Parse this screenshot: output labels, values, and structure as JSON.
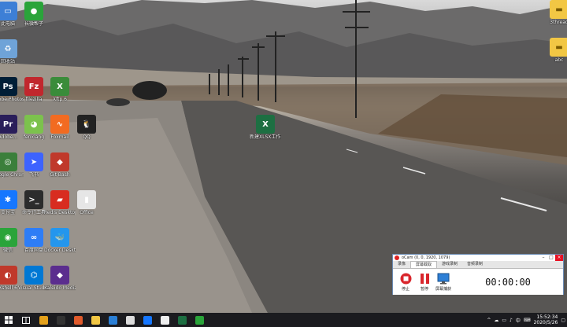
{
  "desktop_icons": [
    {
      "name": "此电脑-icon",
      "label": "此电脑",
      "color": "#3d7fd6",
      "glyph": "▭"
    },
    {
      "name": "wechat-icon",
      "label": "长微帮子",
      "color": "#2aa43a",
      "glyph": "●"
    },
    {
      "name": "recycle-icon",
      "label": "回收站",
      "color": "#6fa3d8",
      "glyph": "♻"
    },
    {
      "name": "photoshop-icon",
      "label": "Adobe Photosh...",
      "color": "#001e36",
      "glyph": "Ps"
    },
    {
      "name": "filezilla-icon",
      "label": "filezilla",
      "color": "#c1272d",
      "glyph": "Fz"
    },
    {
      "name": "xftp-icon",
      "label": "Xftp 6",
      "color": "#3a8c3a",
      "glyph": "X"
    },
    {
      "name": "premiere-icon",
      "label": "Adobe...",
      "color": "#2a1e5a",
      "glyph": "Pr"
    },
    {
      "name": "fenxiang-icon",
      "label": "fenxiang",
      "color": "#7cc24d",
      "glyph": "◕"
    },
    {
      "name": "app-orange-icon",
      "label": "Foxmail",
      "color": "#f26b21",
      "glyph": "∿"
    },
    {
      "name": "qq-icon",
      "label": "QQ",
      "color": "#222",
      "glyph": "🐧"
    },
    {
      "name": "chrome-like-icon",
      "label": "Google Chrome",
      "color": "#3b7f3b",
      "glyph": "◎"
    },
    {
      "name": "feishu-icon",
      "label": "飞书",
      "color": "#3d63ff",
      "glyph": "➤"
    },
    {
      "name": "gitee-icon",
      "label": "Git Bash",
      "color": "#c0392b",
      "glyph": "◆"
    },
    {
      "name": "alipay-icon",
      "label": "支付宝",
      "color": "#1677ff",
      "glyph": "✱"
    },
    {
      "name": "terminal-icon",
      "label": "命令行工具",
      "color": "#2c2c2c",
      "glyph": ">_"
    },
    {
      "name": "redis-icon",
      "label": "Redis Desktop",
      "color": "#d82c20",
      "glyph": "▰"
    },
    {
      "name": "office-icon",
      "label": "Office",
      "color": "#e6e6e6",
      "glyph": "▮"
    },
    {
      "name": "wechat2-icon",
      "label": "微信",
      "color": "#2aa43a",
      "glyph": "◉"
    },
    {
      "name": "baidu-pan-icon",
      "label": "百度网盘",
      "color": "#2e7df6",
      "glyph": "∞"
    },
    {
      "name": "docker-icon",
      "label": "Docker Desktop",
      "color": "#2496ed",
      "glyph": "🐳"
    },
    {
      "name": "shell-icon",
      "label": "Xshell 6",
      "color": "#c0392b",
      "glyph": "◐"
    },
    {
      "name": "vscode-icon",
      "label": "Visual Studio Code",
      "color": "#0078d4",
      "glyph": "⌬"
    },
    {
      "name": "xampp-icon",
      "label": "Kaleido Media",
      "color": "#5b2d8e",
      "glyph": "◆"
    }
  ],
  "right_icons": [
    {
      "name": "folder-ithreal-icon",
      "label": "3thread"
    },
    {
      "name": "folder-abc-icon",
      "label": "abc"
    }
  ],
  "center_file": {
    "label": "新建XLSX工作表"
  },
  "ocam": {
    "title": "oCam (0, 0, 1920, 1079)",
    "tabs": [
      "录像",
      "屏幕截取",
      "游戏录制",
      "音频录制"
    ],
    "tools": [
      {
        "label": "停止",
        "icon": "stop-icon"
      },
      {
        "label": "暂停",
        "icon": "pause-icon"
      },
      {
        "label": "屏幕捕获",
        "icon": "capture-icon"
      }
    ],
    "timer": "00:00:00"
  },
  "taskbar": {
    "time": "15:52:34",
    "date": "2020/5/26",
    "ime": "中",
    "apps": [
      {
        "name": "chrome-taskbar-icon",
        "color": "#e4a11b"
      },
      {
        "name": "terminal-taskbar-icon",
        "color": "#333"
      },
      {
        "name": "fox-taskbar-icon",
        "color": "#e05a2b"
      },
      {
        "name": "folder-taskbar-icon",
        "color": "#f2c744"
      },
      {
        "name": "app-taskbar-icon",
        "color": "#2a7fd6"
      },
      {
        "name": "media-taskbar-icon",
        "color": "#ddd"
      },
      {
        "name": "alipay-taskbar-icon",
        "color": "#1677ff"
      },
      {
        "name": "ocam-taskbar-icon",
        "color": "#eee"
      },
      {
        "name": "excel-taskbar-icon",
        "color": "#1d6f42"
      },
      {
        "name": "wechat-taskbar-icon",
        "color": "#2aa43a"
      }
    ]
  }
}
